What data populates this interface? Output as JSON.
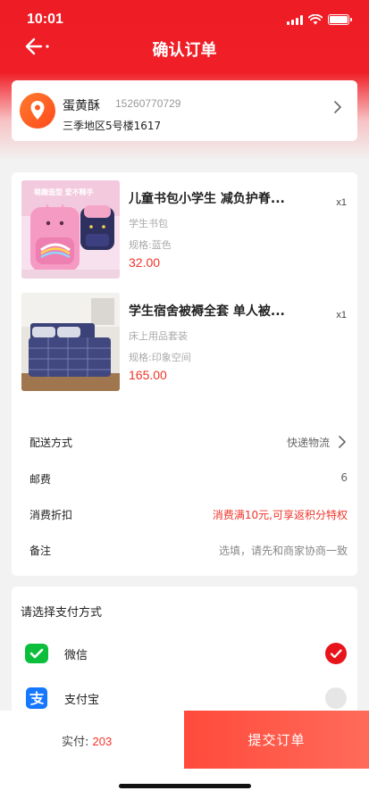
{
  "status_bar": {
    "time": "10:01"
  },
  "nav": {
    "title": "确认订单"
  },
  "address": {
    "name": "蛋黄酥",
    "phone": "15260770729",
    "detail": "三季地区5号楼1617"
  },
  "products": [
    {
      "title": "儿童书包小学生 减负护脊...",
      "category": "学生书包",
      "spec": "规格:蓝色",
      "price": "32.00",
      "qty": "x1",
      "image_banner": "萌趣造型 爱不释手"
    },
    {
      "title": "学生宿舍被褥全套 单人被...",
      "category": "床上用品套装",
      "spec": "规格:印象空间",
      "price": "165.00",
      "qty": "x1"
    }
  ],
  "order_rows": [
    {
      "label": "配送方式",
      "value": "快递物流"
    },
    {
      "label": "邮费",
      "value": "6"
    },
    {
      "label": "消费折扣",
      "value": "消费满10元,可享返积分特权",
      "value_color": "#f0342a"
    },
    {
      "label": "备注",
      "value": "选填，请先和商家协商一致"
    }
  ],
  "payment": {
    "heading": "请选择支付方式",
    "methods": [
      {
        "label": "微信",
        "icon": "wechat-icon",
        "selected": true
      },
      {
        "label": "支付宝",
        "icon": "alipay-icon",
        "selected": false
      }
    ]
  },
  "footer": {
    "total_label": "实付:",
    "total_value": "203",
    "submit_label": "提交订单"
  },
  "colors": {
    "brand_red": "#ee1c25",
    "price_red": "#f0342a",
    "wechat_green": "#0bbf3c",
    "alipay_blue": "#1677ff"
  }
}
